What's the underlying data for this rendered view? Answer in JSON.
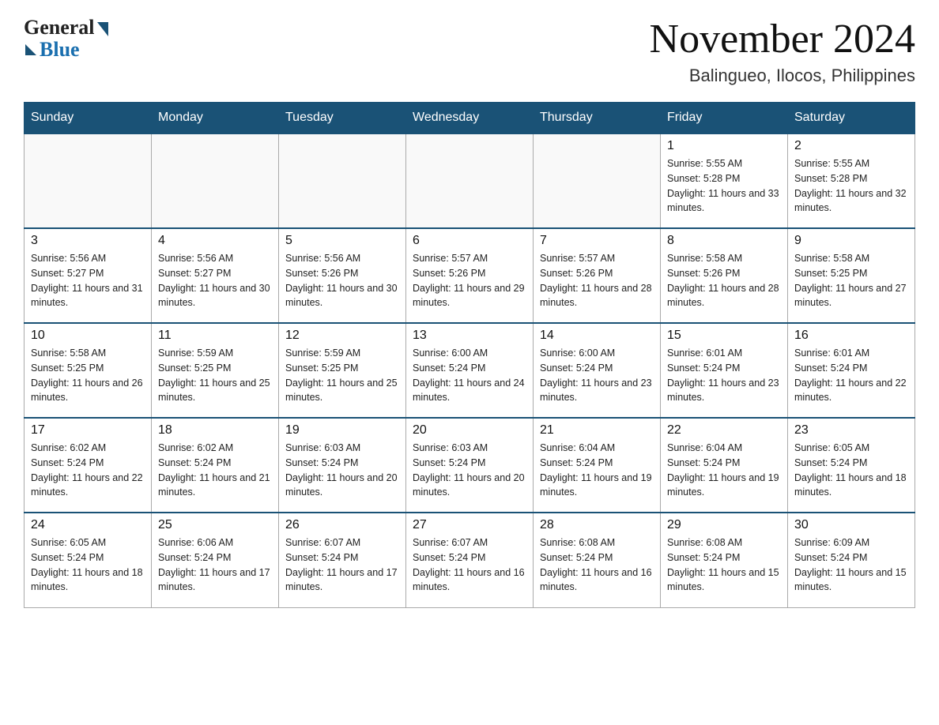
{
  "logo": {
    "general": "General",
    "blue": "Blue"
  },
  "header": {
    "month_title": "November 2024",
    "location": "Balingueo, Ilocos, Philippines"
  },
  "weekdays": [
    "Sunday",
    "Monday",
    "Tuesday",
    "Wednesday",
    "Thursday",
    "Friday",
    "Saturday"
  ],
  "weeks": [
    [
      {
        "day": "",
        "info": ""
      },
      {
        "day": "",
        "info": ""
      },
      {
        "day": "",
        "info": ""
      },
      {
        "day": "",
        "info": ""
      },
      {
        "day": "",
        "info": ""
      },
      {
        "day": "1",
        "info": "Sunrise: 5:55 AM\nSunset: 5:28 PM\nDaylight: 11 hours and 33 minutes."
      },
      {
        "day": "2",
        "info": "Sunrise: 5:55 AM\nSunset: 5:28 PM\nDaylight: 11 hours and 32 minutes."
      }
    ],
    [
      {
        "day": "3",
        "info": "Sunrise: 5:56 AM\nSunset: 5:27 PM\nDaylight: 11 hours and 31 minutes."
      },
      {
        "day": "4",
        "info": "Sunrise: 5:56 AM\nSunset: 5:27 PM\nDaylight: 11 hours and 30 minutes."
      },
      {
        "day": "5",
        "info": "Sunrise: 5:56 AM\nSunset: 5:26 PM\nDaylight: 11 hours and 30 minutes."
      },
      {
        "day": "6",
        "info": "Sunrise: 5:57 AM\nSunset: 5:26 PM\nDaylight: 11 hours and 29 minutes."
      },
      {
        "day": "7",
        "info": "Sunrise: 5:57 AM\nSunset: 5:26 PM\nDaylight: 11 hours and 28 minutes."
      },
      {
        "day": "8",
        "info": "Sunrise: 5:58 AM\nSunset: 5:26 PM\nDaylight: 11 hours and 28 minutes."
      },
      {
        "day": "9",
        "info": "Sunrise: 5:58 AM\nSunset: 5:25 PM\nDaylight: 11 hours and 27 minutes."
      }
    ],
    [
      {
        "day": "10",
        "info": "Sunrise: 5:58 AM\nSunset: 5:25 PM\nDaylight: 11 hours and 26 minutes."
      },
      {
        "day": "11",
        "info": "Sunrise: 5:59 AM\nSunset: 5:25 PM\nDaylight: 11 hours and 25 minutes."
      },
      {
        "day": "12",
        "info": "Sunrise: 5:59 AM\nSunset: 5:25 PM\nDaylight: 11 hours and 25 minutes."
      },
      {
        "day": "13",
        "info": "Sunrise: 6:00 AM\nSunset: 5:24 PM\nDaylight: 11 hours and 24 minutes."
      },
      {
        "day": "14",
        "info": "Sunrise: 6:00 AM\nSunset: 5:24 PM\nDaylight: 11 hours and 23 minutes."
      },
      {
        "day": "15",
        "info": "Sunrise: 6:01 AM\nSunset: 5:24 PM\nDaylight: 11 hours and 23 minutes."
      },
      {
        "day": "16",
        "info": "Sunrise: 6:01 AM\nSunset: 5:24 PM\nDaylight: 11 hours and 22 minutes."
      }
    ],
    [
      {
        "day": "17",
        "info": "Sunrise: 6:02 AM\nSunset: 5:24 PM\nDaylight: 11 hours and 22 minutes."
      },
      {
        "day": "18",
        "info": "Sunrise: 6:02 AM\nSunset: 5:24 PM\nDaylight: 11 hours and 21 minutes."
      },
      {
        "day": "19",
        "info": "Sunrise: 6:03 AM\nSunset: 5:24 PM\nDaylight: 11 hours and 20 minutes."
      },
      {
        "day": "20",
        "info": "Sunrise: 6:03 AM\nSunset: 5:24 PM\nDaylight: 11 hours and 20 minutes."
      },
      {
        "day": "21",
        "info": "Sunrise: 6:04 AM\nSunset: 5:24 PM\nDaylight: 11 hours and 19 minutes."
      },
      {
        "day": "22",
        "info": "Sunrise: 6:04 AM\nSunset: 5:24 PM\nDaylight: 11 hours and 19 minutes."
      },
      {
        "day": "23",
        "info": "Sunrise: 6:05 AM\nSunset: 5:24 PM\nDaylight: 11 hours and 18 minutes."
      }
    ],
    [
      {
        "day": "24",
        "info": "Sunrise: 6:05 AM\nSunset: 5:24 PM\nDaylight: 11 hours and 18 minutes."
      },
      {
        "day": "25",
        "info": "Sunrise: 6:06 AM\nSunset: 5:24 PM\nDaylight: 11 hours and 17 minutes."
      },
      {
        "day": "26",
        "info": "Sunrise: 6:07 AM\nSunset: 5:24 PM\nDaylight: 11 hours and 17 minutes."
      },
      {
        "day": "27",
        "info": "Sunrise: 6:07 AM\nSunset: 5:24 PM\nDaylight: 11 hours and 16 minutes."
      },
      {
        "day": "28",
        "info": "Sunrise: 6:08 AM\nSunset: 5:24 PM\nDaylight: 11 hours and 16 minutes."
      },
      {
        "day": "29",
        "info": "Sunrise: 6:08 AM\nSunset: 5:24 PM\nDaylight: 11 hours and 15 minutes."
      },
      {
        "day": "30",
        "info": "Sunrise: 6:09 AM\nSunset: 5:24 PM\nDaylight: 11 hours and 15 minutes."
      }
    ]
  ]
}
